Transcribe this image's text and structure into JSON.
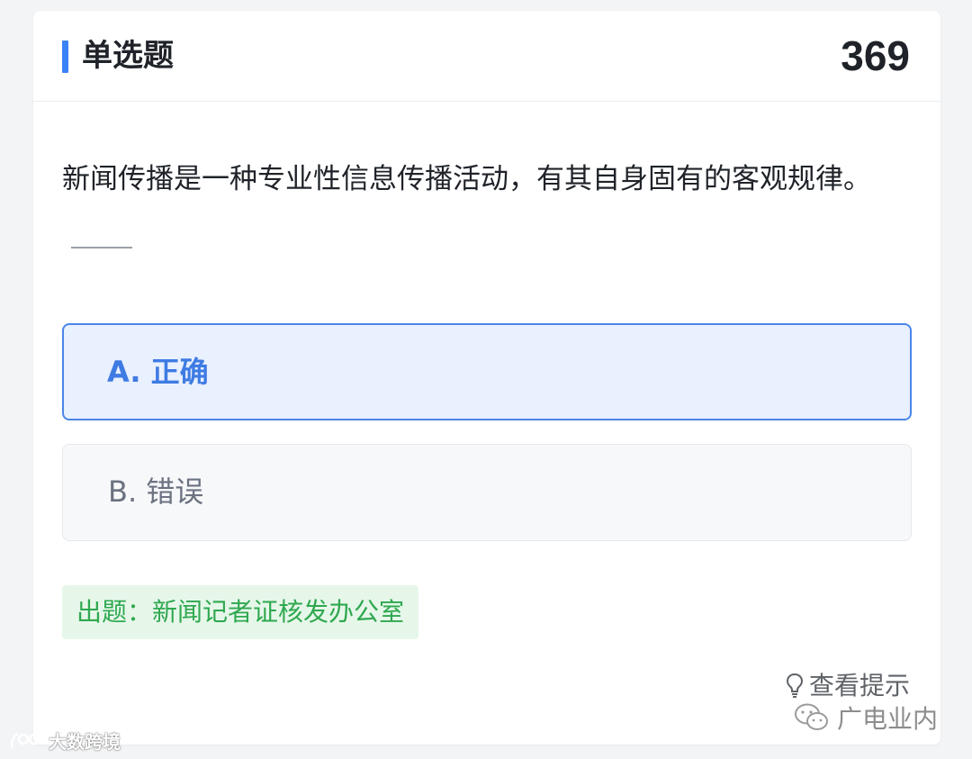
{
  "header": {
    "type_label": "单选题",
    "question_number": "369"
  },
  "question": {
    "text": "新闻传播是一种专业性信息传播活动，有其自身固有的客观规律。"
  },
  "options": [
    {
      "label": "A. 正确",
      "selected": true
    },
    {
      "label": "B. 错误",
      "selected": false
    }
  ],
  "source": {
    "text": "出题：新闻记者证核发办公室"
  },
  "hint": {
    "label": "查看提示",
    "icon": "lightbulb-icon"
  },
  "watermarks": {
    "right": "广电业内",
    "left": "大数跨境"
  },
  "colors": {
    "accent": "#3b82f6",
    "selected_bg": "#e9f0fe",
    "selected_border": "#4a86e8",
    "source_bg": "#e6f7ea",
    "source_text": "#2fa84f"
  }
}
